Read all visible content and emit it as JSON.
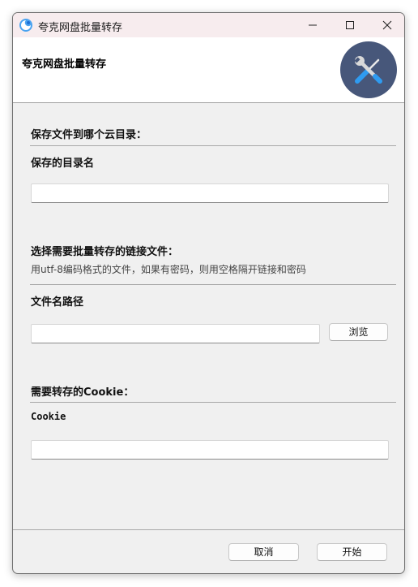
{
  "window": {
    "title": "夸克网盘批量转存"
  },
  "header": {
    "title": "夸克网盘批量转存",
    "badge_icon": "tools-icon",
    "badge_color": "#47577a"
  },
  "save_section": {
    "title": "保存文件到哪个云目录：",
    "field_label": "保存的目录名",
    "value": ""
  },
  "link_section": {
    "title": "选择需要批量转存的链接文件：",
    "description": "用utf-8编码格式的文件，如果有密码，则用空格隔开链接和密码",
    "field_label": "文件名路径",
    "value": "",
    "browse_label": "浏览"
  },
  "cookie_section": {
    "title": "需要转存的Cookie：",
    "field_label": "Cookie",
    "value": ""
  },
  "footer": {
    "cancel_label": "取消",
    "start_label": "开始"
  }
}
